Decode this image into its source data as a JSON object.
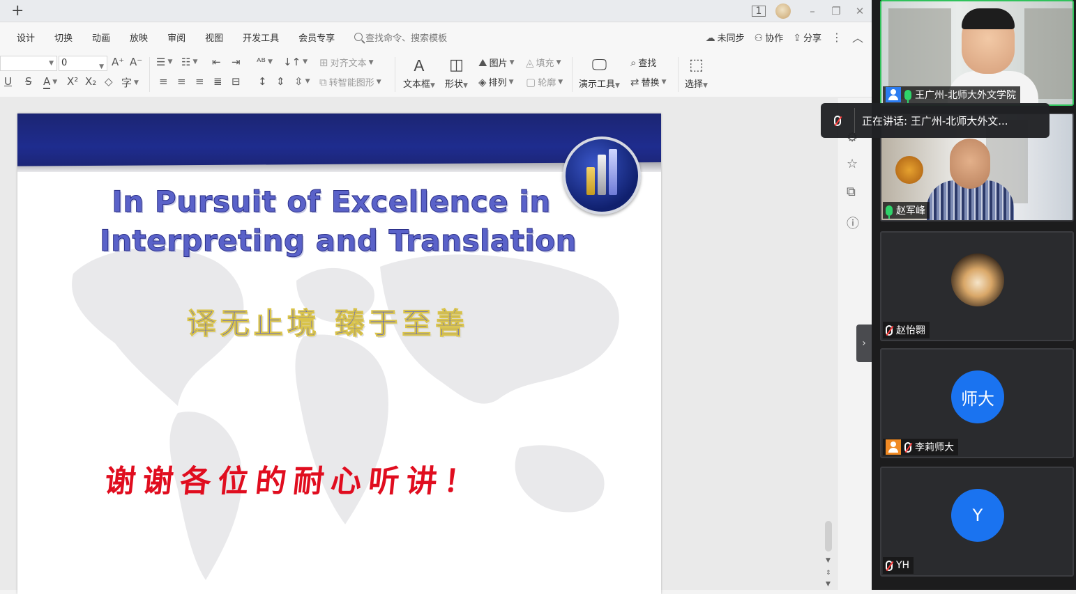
{
  "titlebar": {
    "new_tab": "+",
    "page_badge": "1",
    "min": "–",
    "restore": "❐",
    "close": "✕"
  },
  "menu": {
    "items": [
      "设计",
      "切换",
      "动画",
      "放映",
      "审阅",
      "视图",
      "开发工具",
      "会员专享"
    ],
    "search_placeholder": "查找命令、搜索模板",
    "right": {
      "sync": "未同步",
      "collab": "协作",
      "share": "分享"
    }
  },
  "toolbar": {
    "font_size": "0",
    "align_text": "对齐文本",
    "smart_shape": "转智能图形",
    "text_box": "文本框",
    "shape": "形状",
    "picture": "图片",
    "arrange": "排列",
    "fill": "填充",
    "outline": "轮廓",
    "present_tools": "演示工具",
    "find": "查找",
    "replace": "替换",
    "select": "选择"
  },
  "slide": {
    "title_line1": "In Pursuit of Excellence in",
    "title_line2": "Interpreting and Translation",
    "subtitle": "译无止境  臻于至善",
    "thanks": "谢谢各位的耐心听讲！"
  },
  "meeting": {
    "speaking_tip": "正在讲话: 王广州-北师大外文...",
    "participants": [
      {
        "name": "王广州-北师大外文学院",
        "mic": "on"
      },
      {
        "name": "赵军峰",
        "mic": "on"
      },
      {
        "name": "赵怡翾",
        "mic": "off"
      },
      {
        "name": "李莉师大",
        "mic": "off",
        "avatar_text": "师大"
      },
      {
        "name": "YH",
        "mic": "off",
        "avatar_text": "Y"
      }
    ]
  },
  "colors": {
    "accent_blue": "#1a73f0",
    "mic_green": "#2fd36a",
    "slide_title": "#5a62c9",
    "thanks_red": "#e00d1f",
    "slide_band": "#1e2c8e"
  }
}
